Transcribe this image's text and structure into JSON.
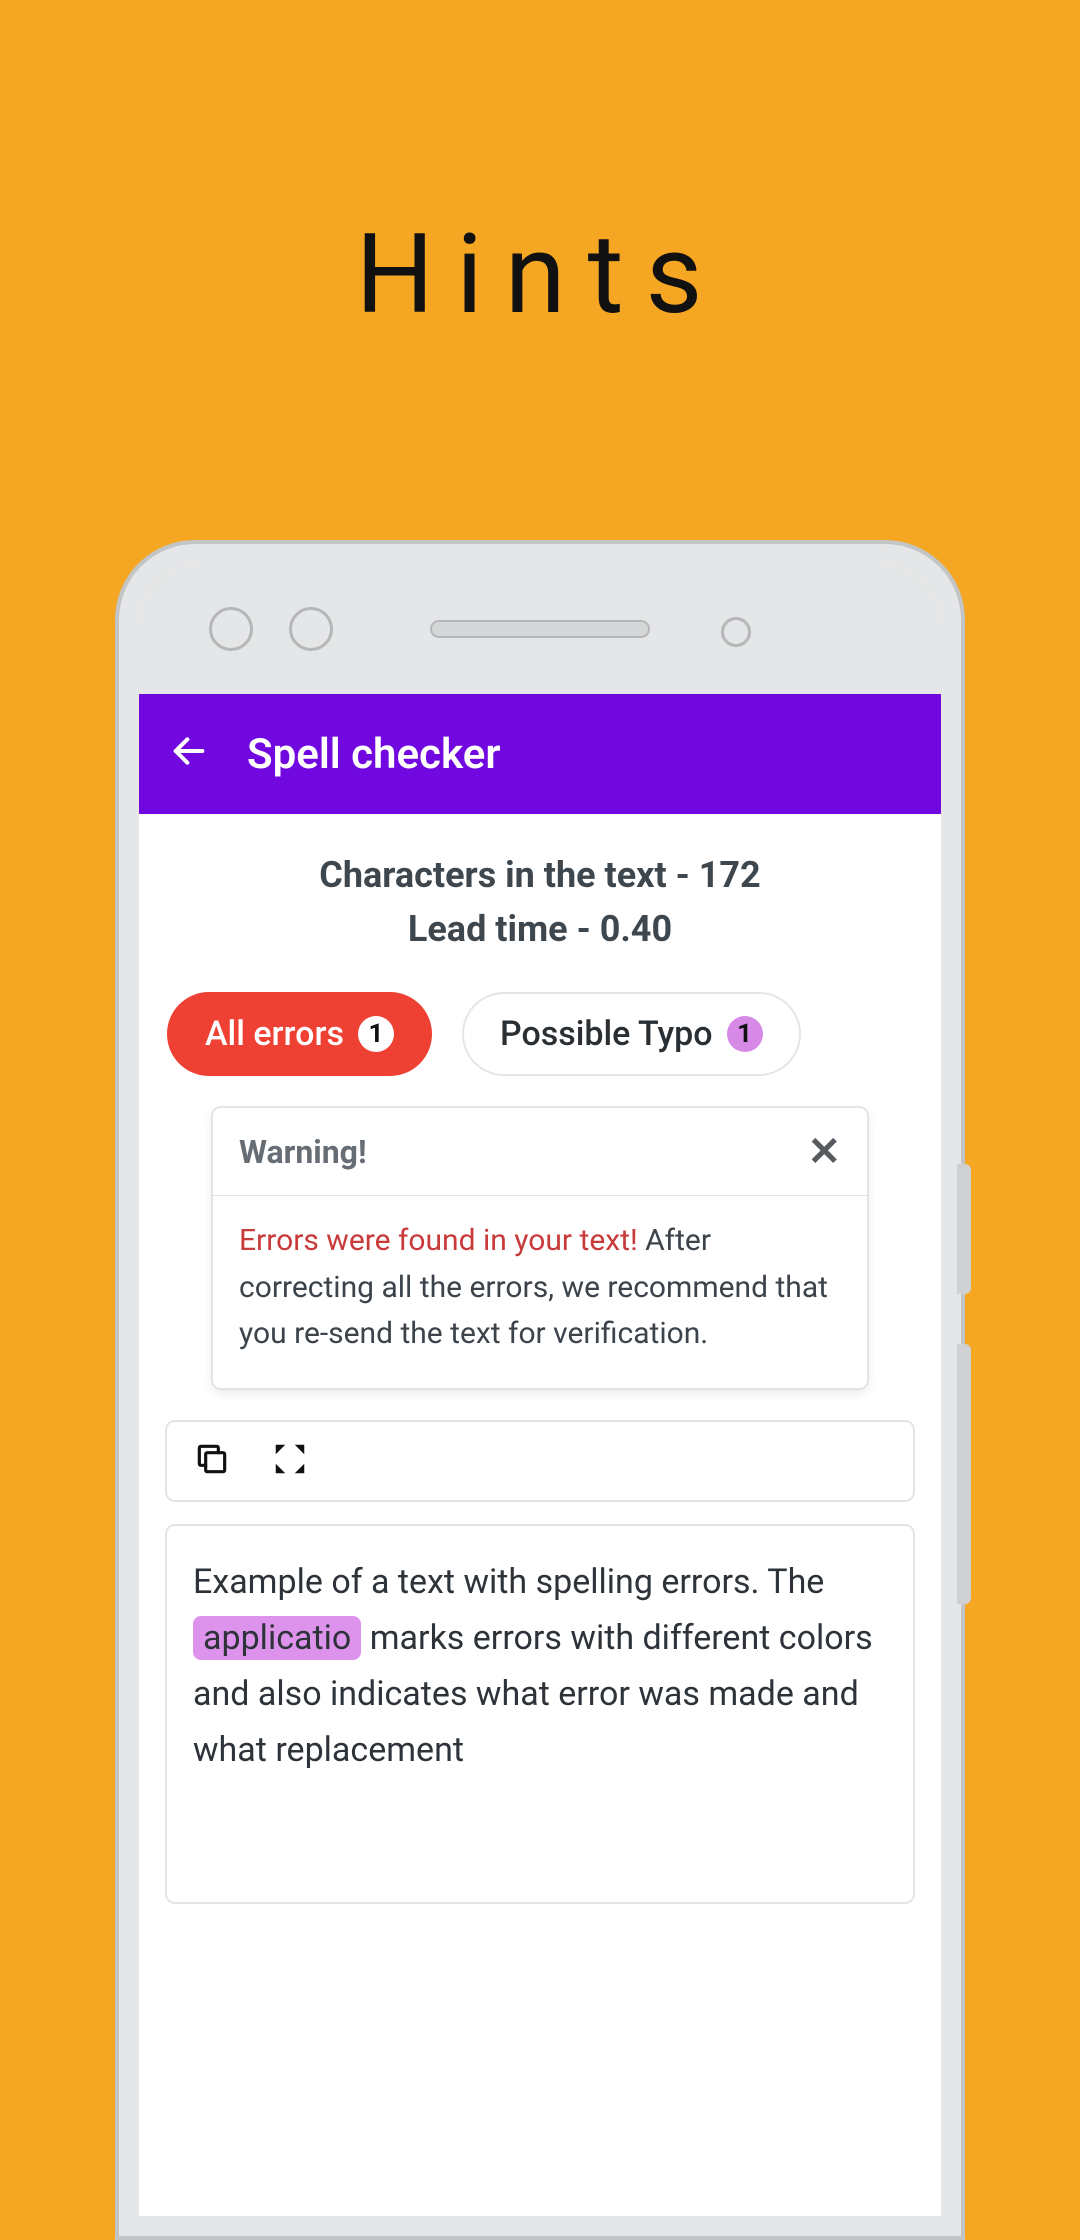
{
  "promo": {
    "title": "Hints"
  },
  "appbar": {
    "title": "Spell checker"
  },
  "stats": {
    "line1": "Characters in the text - 172",
    "line2": "Lead time - 0.40"
  },
  "filters": {
    "all_errors": {
      "label": "All errors",
      "count": "1"
    },
    "possible_typo": {
      "label": "Possible Typo",
      "count": "1"
    }
  },
  "warning": {
    "title": "Warning!",
    "lead": "Errors were found in your text!",
    "rest": " After correcting all the errors, we recommend that you re-send the text for verification."
  },
  "text_sample": {
    "pre": "Example of a text with spelling errors. The ",
    "highlight": "applicatio",
    "post": " marks errors with different colors and also indicates what error was made and what replacement"
  }
}
